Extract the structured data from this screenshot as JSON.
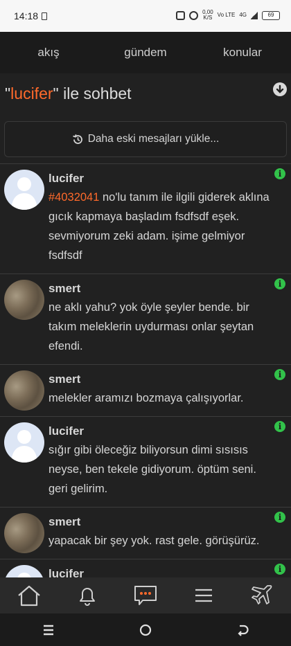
{
  "status": {
    "time": "14:18",
    "kbs": "0,00",
    "kbs_unit": "K/S",
    "net1": "Vo LTE",
    "net2": "4G",
    "battery": "69"
  },
  "nav": {
    "tabs": [
      "akış",
      "gündem",
      "konular"
    ]
  },
  "title": {
    "open_quote": "\"",
    "name": "lucifer",
    "close_quote": "\"",
    "suffix": " ile sohbet"
  },
  "load_more": "Daha eski mesajları yükle...",
  "messages": [
    {
      "author": "lucifer",
      "avatar": "default",
      "ref": "#4032041",
      "text": " no'lu tanım ile ilgili giderek aklına gıcık kapmaya başladım fsdfsdf eşek. sevmiyorum zeki adam. işime gelmiyor fsdfsdf"
    },
    {
      "author": "smert",
      "avatar": "photo",
      "ref": "",
      "text": "ne aklı yahu? yok öyle şeyler bende. bir takım meleklerin uydurması onlar şeytan efendi."
    },
    {
      "author": "smert",
      "avatar": "photo",
      "ref": "",
      "text": "melekler aramızı bozmaya çalışıyorlar."
    },
    {
      "author": "lucifer",
      "avatar": "default",
      "ref": "",
      "text": "sığır gibi öleceğiz biliyorsun dimi sısısıs neyse, ben tekele gidiyorum. öptüm seni. geri gelirim."
    },
    {
      "author": "smert",
      "avatar": "photo",
      "ref": "",
      "text": "yapacak bir şey yok. rast gele. görüşürüz."
    },
    {
      "author": "lucifer",
      "avatar": "default",
      "ref": "",
      "text": ""
    }
  ],
  "info_glyph": "i",
  "bottom_nav": [
    "home-icon",
    "bell-icon",
    "chat-icon",
    "menu-icon",
    "plane-icon"
  ],
  "colors": {
    "accent": "#ff6a2b",
    "info": "#32c24a",
    "background": "#212121"
  }
}
